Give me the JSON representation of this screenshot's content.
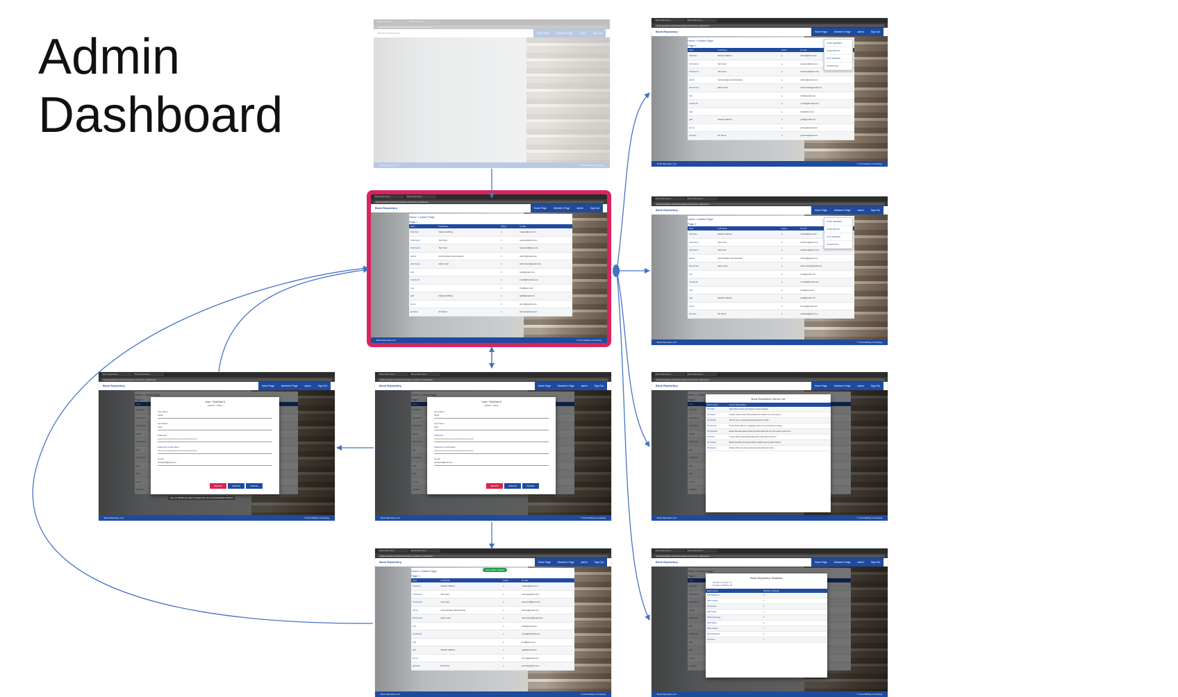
{
  "title": {
    "line1": "Admin",
    "line2": "Dashboard"
  },
  "colors": {
    "highlight": "#d8245e",
    "brand": "#1e4ba0",
    "arrow": "#4472c4",
    "success": "#21a04b",
    "danger": "#d8244e"
  },
  "browser": {
    "tab": "Book Repository",
    "url": "book-repository.virtual.herokuapp.com/admin_dashboard"
  },
  "app": {
    "brand": "Book Repository",
    "nav": {
      "home": "Home Page",
      "members": "Member's Page",
      "admin": "admin",
      "signout": "Sign Out"
    },
    "footer_left": "Book Repository LLC",
    "footer_right": "© Josh Gaffney Computing"
  },
  "breadcrumb": "Home  »  Admin Page",
  "page_label": "Page 1",
  "users_table": {
    "headers": [
      "User",
      "Full Name",
      "Active",
      "E-mail"
    ],
    "rows": [
      {
        "user": "TestUser",
        "name": "Nassar Gaffney",
        "email": "nassar@test.com"
      },
      {
        "user": "TestUser2",
        "name": "Test User",
        "email": "testuser@test.com"
      },
      {
        "user": "TestUser3",
        "name": "Test User",
        "email": "testuser3@test.com"
      },
      {
        "user": "admin",
        "name": "Administrator Administrator",
        "email": "admin@gmail.com"
      },
      {
        "user": "adminuser",
        "name": "admin user",
        "email": "adminuser@gmail.com"
      },
      {
        "user": "bob",
        "name": "",
        "email": "bob@gmail.com"
      },
      {
        "user": "crockrock",
        "name": "",
        "email": "crock@hotmail.com"
      },
      {
        "user": "fred",
        "name": "",
        "email": "fred@test.com"
      },
      {
        "user": "geff",
        "name": "Nassar Gaffney",
        "email": "geff@gmail.com"
      },
      {
        "user": "jimmy",
        "name": "",
        "email": "jimmy@gmail.com"
      },
      {
        "user": "johndoe",
        "name": "Mr Tarnel",
        "email": "johndoe@test.com"
      }
    ]
  },
  "admin_menu": [
    "LOAD GENRES",
    "LOAD BOOKS",
    "LIST GENRES",
    "STATISTICS"
  ],
  "edit_modal": {
    "title": "User: TestUser3",
    "inactive": "Inactive",
    "active": "Active",
    "fields": [
      {
        "label": "First Name",
        "value": "Test3"
      },
      {
        "label": "Last Name",
        "value": "User"
      },
      {
        "label": "Password",
        "value": "••••••••••••••••••••••••••••••••••••••••••••••••••••••"
      },
      {
        "label": "Password Confirmation",
        "value": "••••••••••••••••••••••••••••••••••••••••••••••••••••••"
      },
      {
        "label": "E-mail",
        "value": "testuser3@test.com"
      }
    ],
    "buttons": [
      "DELETE",
      "UPDATE",
      "CANCEL"
    ],
    "tooltip": "Are you SURE you want to delete this user and associated records?"
  },
  "toast": "User profile updated",
  "genres": {
    "title": "Book Repository Genre List",
    "headers": [
      "Book Genre",
      "Genre Description"
    ],
    "rows": [
      {
        "genre": "SF Action",
        "desc": "High stakes stories with frequent scene changes."
      },
      {
        "genre": "SF Classic",
        "desc": "Classic science fiction that predates the modern era of the genre."
      },
      {
        "genre": "SF Fantasy",
        "desc": "Stories set in a completely fictional world or realm."
      },
      {
        "genre": "SF General",
        "desc": "These books offer fun, engaging stories in a contemporary setting."
      },
      {
        "genre": "SF Historical",
        "desc": "Books that take place at least 25 years before the time the author wrote them."
      },
      {
        "genre": "SF Horror",
        "desc": "A novel where supernatural elements create fear and terror."
      },
      {
        "genre": "SF Literary",
        "desc": "Books described as having artistic qualities and complex themes."
      },
      {
        "genre": "SF Mystery",
        "desc": "Stories where the plot revolves around solving the crime."
      }
    ]
  },
  "stats": {
    "title": "Book Repository Statistics",
    "summary": [
      "Number of Users: 11",
      "Number of Books: 15"
    ],
    "headers": [
      "Book Genre",
      "Number of Books"
    ],
    "rows": [
      {
        "genre": "TNF Reference",
        "n": "2"
      },
      {
        "genre": "NNF Cooking",
        "n": "1"
      },
      {
        "genre": "SF Fantasy",
        "n": "3"
      },
      {
        "genre": "NNF Social",
        "n": "1"
      },
      {
        "genre": "NNF Psychology",
        "n": "2"
      },
      {
        "genre": "NNF History",
        "n": "1"
      },
      {
        "genre": "NNF Cookery",
        "n": "1"
      },
      {
        "genre": "NNF Philosophy",
        "n": "1"
      },
      {
        "genre": "SF Fiction",
        "n": "1"
      }
    ]
  }
}
